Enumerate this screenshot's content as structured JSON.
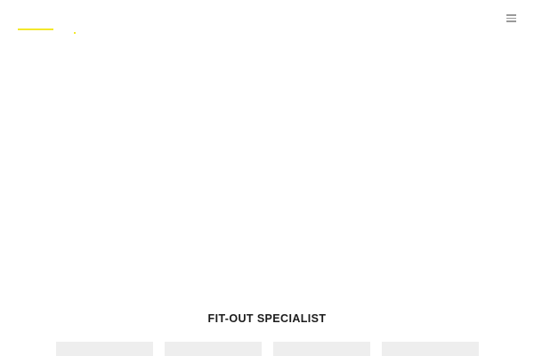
{
  "header": {
    "logo_name": "site-logo",
    "menu_icon": "hamburger-menu-icon"
  },
  "section": {
    "title": "FIT-OUT SPECIALIST",
    "cards": [
      {
        "label": ""
      },
      {
        "label": ""
      },
      {
        "label": ""
      },
      {
        "label": ""
      }
    ]
  },
  "colors": {
    "accent": "#f3e82c",
    "menu_icon": "#9a9a9a",
    "card_placeholder": "#eeeeee",
    "title_text": "#1b1b1b"
  }
}
